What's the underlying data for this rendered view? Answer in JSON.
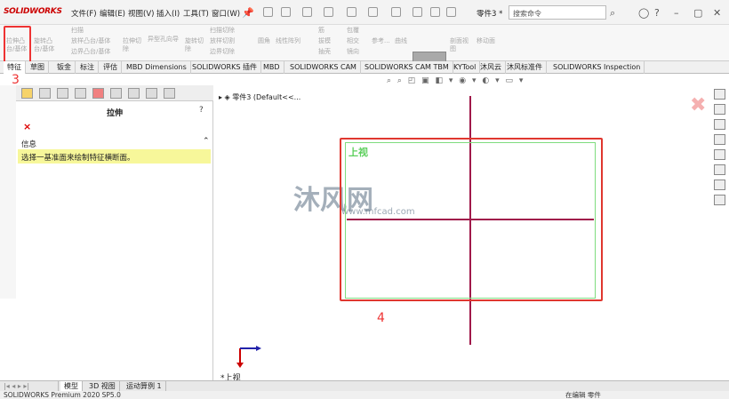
{
  "app": {
    "logo": "SOLIDWORKS",
    "doc_name": "零件3 *"
  },
  "menu": [
    "文件(F)",
    "编辑(E)",
    "视图(V)",
    "插入(I)",
    "工具(T)",
    "窗口(W)"
  ],
  "search": {
    "placeholder": "搜索命令"
  },
  "ribbon": {
    "extrude_boss": "拉伸凸台/基体",
    "revolve_boss": "旋转凸台/基体",
    "sweep": "扫描",
    "loft": "放样凸台/基体",
    "boundary_boss": "边界凸台/基体",
    "extrude_cut": "拉伸切除",
    "hole_wizard": "异型孔向导",
    "revolve_cut": "旋转切除",
    "sweep_cut": "扫描切除",
    "loft_cut": "放样切割",
    "boundary_cut": "边界切除",
    "fillet": "圆角",
    "linear_pattern": "线性阵列",
    "rib": "筋",
    "draft": "拔模",
    "shell": "抽壳",
    "wrap": "包覆",
    "intersect": "相交",
    "mirror": "镜向",
    "ref_geometry": "参考...",
    "curves": "曲线",
    "instant3d": "Instant3D",
    "section_view": "剖面视图",
    "move_face": "移动面"
  },
  "tabs": [
    "特征",
    "草图",
    "钣金",
    "标注",
    "评估",
    "MBD Dimensions",
    "SOLIDWORKS 插件",
    "MBD",
    "SOLIDWORKS CAM",
    "SOLIDWORKS CAM TBM",
    "KYTool",
    "沐风云",
    "沐风标准件",
    "SOLIDWORKS Inspection"
  ],
  "property_manager": {
    "title": "拉伸",
    "help": "?",
    "close": "×",
    "info_heading": "信息",
    "info_message": "选择一基准面来绘制特征横断面。"
  },
  "annotations": {
    "step3": "3",
    "step4": "4"
  },
  "tree": {
    "root": "零件3  (Default<<..."
  },
  "viewport": {
    "plane_label": "上视",
    "current_view": "*上视",
    "watermark": "沐风网",
    "watermark_url": "www.mfcad.com"
  },
  "bottom_tabs": [
    "模型",
    "3D 视图",
    "运动算例 1"
  ],
  "status": {
    "left": "SOLIDWORKS Premium 2020 SP5.0",
    "right": "在编辑 零件"
  },
  "colors": {
    "annotation_red": "#e0372f",
    "plane_green": "#5ccf5c",
    "axis_line": "#a0194a",
    "info_yellow": "#f7f79a"
  }
}
